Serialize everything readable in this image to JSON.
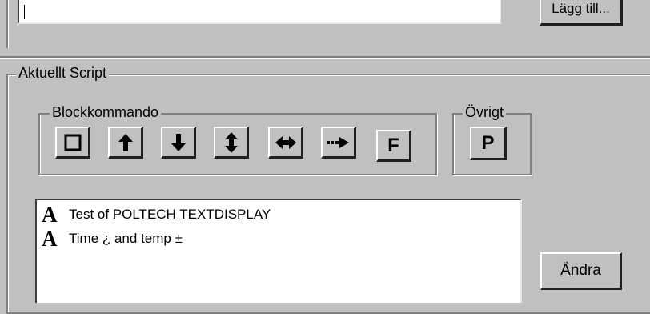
{
  "top": {
    "button_label": "Lägg till..."
  },
  "aktuellt_script": {
    "title": "Aktuellt Script"
  },
  "blockkommando": {
    "title": "Blockkommando",
    "buttons": [
      {
        "icon": "square-icon"
      },
      {
        "icon": "arrow-up-icon"
      },
      {
        "icon": "arrow-down-icon"
      },
      {
        "icon": "arrow-up-down-icon"
      },
      {
        "icon": "arrow-left-right-icon"
      },
      {
        "icon": "dotted-arrow-right-icon"
      },
      {
        "icon": "letter-f-icon",
        "label": "F"
      }
    ]
  },
  "ovrigt": {
    "title": "Övrigt",
    "buttons": [
      {
        "icon": "letter-p-icon",
        "label": "P"
      }
    ]
  },
  "script_list": {
    "items": [
      {
        "icon": "text-a-icon",
        "icon_glyph": "A",
        "text": "Test of POLTECH TEXTDISPLAY"
      },
      {
        "icon": "text-a-icon",
        "icon_glyph": "A",
        "text": "Time ¿ and temp ±"
      }
    ]
  },
  "andra_button": {
    "accel": "Ä",
    "rest": "ndra"
  }
}
